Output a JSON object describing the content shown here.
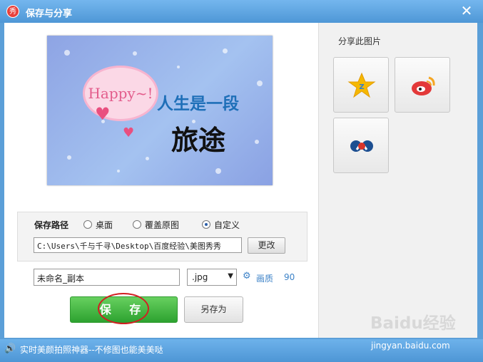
{
  "window": {
    "title": "保存与分享",
    "app_icon_text": "秀",
    "close_symbol": "✕"
  },
  "preview": {
    "bubble_text": "Happy~!",
    "text_line1": "人生是一段",
    "text_line2": "旅途"
  },
  "save_path": {
    "label": "保存路径",
    "options": [
      "桌面",
      "覆盖原图",
      "自定义"
    ],
    "selected": "自定义",
    "path_value": "C:\\Users\\千与千寻\\Desktop\\百度经验\\美图秀秀",
    "change_button": "更改"
  },
  "file": {
    "name_value": "未命名_副本",
    "format_value": ".jpg",
    "quality_label": "画质",
    "quality_value": "90"
  },
  "actions": {
    "save": "保 存",
    "save_as": "另存为"
  },
  "share": {
    "title": "分享此图片",
    "targets": [
      "qzone-icon",
      "weibo-icon",
      "renren-icon"
    ]
  },
  "status": {
    "message": "实时美颜拍照神器--不修图也能美美哒",
    "watermark_logo": "Baidu经验",
    "watermark_url": "jingyan.baidu.com"
  },
  "colors": {
    "title_blue": "#4e97d6",
    "save_green": "#2da230",
    "highlight_red": "#d21f22"
  }
}
